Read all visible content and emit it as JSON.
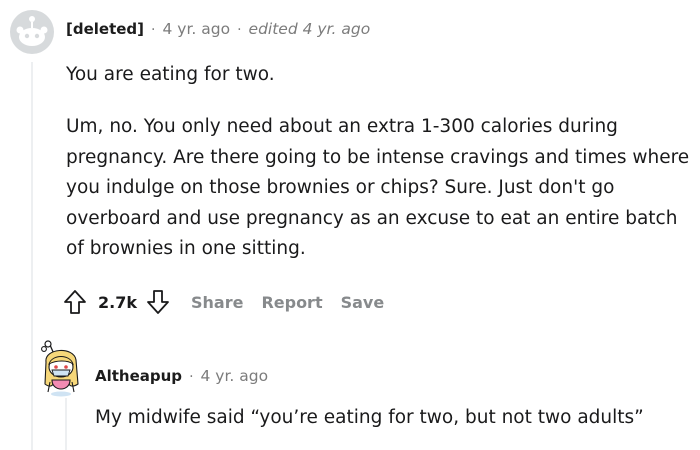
{
  "comment_1": {
    "author": "[deleted]",
    "separator": "·",
    "time": "4 yr. ago",
    "edited": "edited 4 yr. ago",
    "avatar": "deleted-user-avatar-icon",
    "paragraphs": [
      "You are eating for two.",
      "Um, no. You only need about an extra 1-300 calories during pregnancy. Are there going to be intense cravings and times where you indulge on those brownies or chips? Sure. Just don't go overboard and use pregnancy as an excuse to eat an entire batch of brownies in one sitting."
    ],
    "actions": {
      "upvote_icon": "upvote-arrow-icon",
      "score": "2.7k",
      "downvote_icon": "downvote-arrow-icon",
      "share": "Share",
      "report": "Report",
      "save": "Save"
    }
  },
  "comment_2": {
    "author": "Altheapup",
    "separator": "·",
    "time": "4 yr. ago",
    "avatar": "snoo-avatar-icon",
    "text": "My midwife said “you’re eating for two, but not two adults”"
  },
  "colors": {
    "text": "#1a1a1b",
    "meta": "#7c7c7c",
    "action": "#878a8c",
    "thread_line": "#edeff1",
    "avatar_gray": "#d7dadc"
  }
}
